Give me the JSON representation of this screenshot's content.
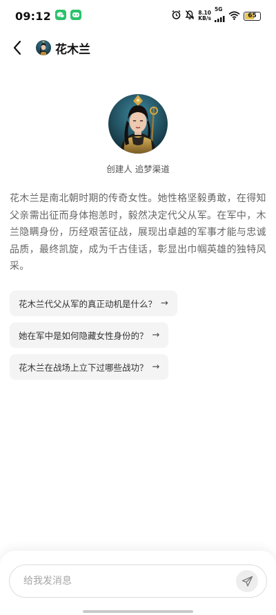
{
  "status_bar": {
    "time": "09:12",
    "net_speed_value": "8.10",
    "net_speed_unit": "KB/s",
    "network_type": "5G",
    "battery_level": "65",
    "battery_fraction": 0.65,
    "icons": [
      "wechat-icon",
      "app-notification-icon",
      "alarm-icon",
      "mute-icon",
      "signal-icon",
      "wifi-icon",
      "battery-icon"
    ]
  },
  "header": {
    "back_icon": "chevron-left-icon",
    "title": "花木兰"
  },
  "profile": {
    "creator_text": "创建人 追梦渠道"
  },
  "description": "花木兰是南北朝时期的传奇女性。她性格坚毅勇敢，在得知父亲需出征而身体抱恙时，毅然决定代父从军。在军中，木兰隐瞒身份，历经艰苦征战，展现出卓越的军事才能与忠诚品质，最终凯旋，成为千古佳话，彰显出巾帼英雄的独特风采。",
  "suggestions": [
    {
      "label": "花木兰代父从军的真正动机是什么？"
    },
    {
      "label": "她在军中是如何隐藏女性身份的？"
    },
    {
      "label": "花木兰在战场上立下过哪些战功？"
    }
  ],
  "suggestion_arrow": "→",
  "input": {
    "placeholder": "给我发消息",
    "value": ""
  },
  "colors": {
    "accent_green": "#2bc26b",
    "battery": "#e9c44f",
    "chip_bg": "#f4f4f5"
  }
}
